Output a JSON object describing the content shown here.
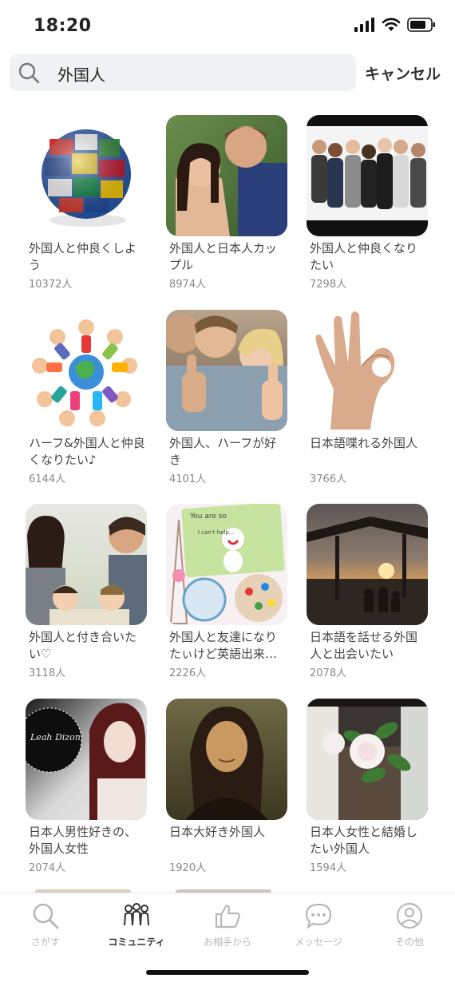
{
  "status": {
    "time": "18:20"
  },
  "search": {
    "query": "外国人",
    "cancel_label": "キャンセル"
  },
  "communities": [
    {
      "title": "外国人と仲良くしよう",
      "count": "10372人"
    },
    {
      "title": "外国人と日本人カップル",
      "count": "8974人"
    },
    {
      "title": "外国人と仲良くなりたい",
      "count": "7298人"
    },
    {
      "title": "ハーフ&外国人と仲良くなりたい♪",
      "count": "6144人"
    },
    {
      "title": "外国人、ハーフが好き",
      "count": "4101人"
    },
    {
      "title": "日本語喋れる外国人",
      "count": "3766人"
    },
    {
      "title": "外国人と付き合いたい♡",
      "count": "3118人"
    },
    {
      "title": "外国人と友達になりたぃけど英語出来…",
      "count": "2226人"
    },
    {
      "title": "日本語を話せる外国人と出会いたい",
      "count": "2078人"
    },
    {
      "title": "日本人男性好きの、外国人女性",
      "count": "2074人"
    },
    {
      "title": "日本大好き外国人",
      "count": "1920人"
    },
    {
      "title": "日本人女性と結婚したい外国人",
      "count": "1594人"
    }
  ],
  "thumb_text": {
    "leah": "Leah Dizon",
    "youare": "You are so",
    "canthelp": "I can't help..."
  },
  "tabs": [
    {
      "label": "さがす",
      "icon": "search-icon"
    },
    {
      "label": "コミュニティ",
      "icon": "community-icon"
    },
    {
      "label": "お相手から",
      "icon": "thumbs-up-icon"
    },
    {
      "label": "メッセージ",
      "icon": "message-icon"
    },
    {
      "label": "その他",
      "icon": "person-icon"
    }
  ],
  "colors": {
    "active_tab": "#333333",
    "inactive_tab": "#b8b8b8",
    "search_bg": "#f0f1f3"
  }
}
